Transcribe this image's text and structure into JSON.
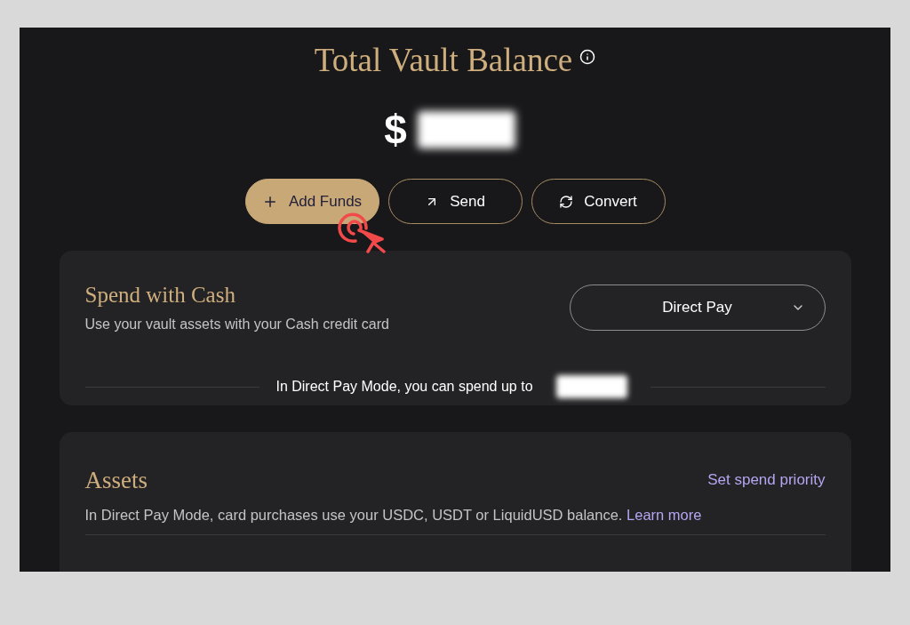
{
  "header": {
    "title": "Total Vault Balance",
    "balance_currency": "$"
  },
  "actions": [
    {
      "label": "Add Funds",
      "kind": "primary"
    },
    {
      "label": "Send",
      "kind": "outline"
    },
    {
      "label": "Convert",
      "kind": "outline"
    }
  ],
  "spend_card": {
    "title": "Spend with Cash",
    "subtitle": "Use your vault assets with your Cash credit card",
    "mode_select": {
      "value": "Direct Pay"
    },
    "limit_text": "In Direct Pay Mode, you can spend up to"
  },
  "assets_card": {
    "title": "Assets",
    "action_link": "Set spend priority",
    "description": "In Direct Pay Mode, card purchases use your USDC, USDT or LiquidUSD balance.",
    "description_link": "Learn more"
  }
}
